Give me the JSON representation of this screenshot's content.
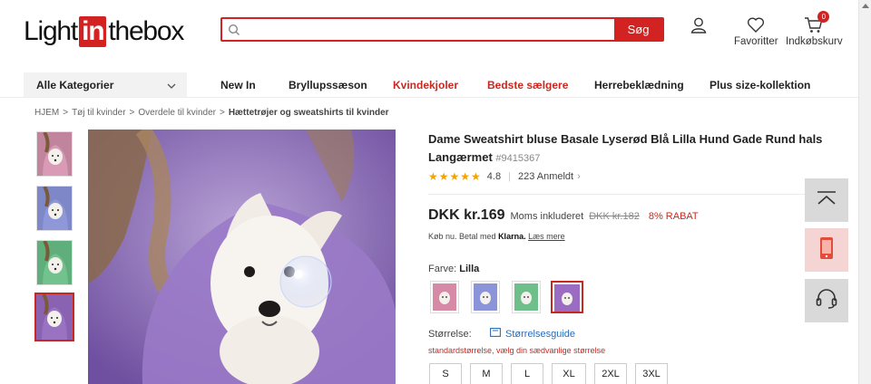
{
  "header": {
    "logo": {
      "pre": "Light",
      "mid": "in",
      "post": "thebox"
    },
    "search": {
      "placeholder": "",
      "button": "Søg"
    },
    "favorites": "Favoritter",
    "cart": {
      "label": "Indkøbskurv",
      "count": "0"
    },
    "icons": [
      "search-icon",
      "account-icon",
      "heart-icon",
      "cart-icon"
    ]
  },
  "nav": {
    "category": "Alle Kategorier",
    "items": [
      {
        "label": "New In",
        "highlight": false
      },
      {
        "label": "Bryllupssæson",
        "highlight": false
      },
      {
        "label": "Kvindekjoler",
        "highlight": true
      },
      {
        "label": "Bedste sælgere",
        "highlight": true
      },
      {
        "label": "Herrebeklædning",
        "highlight": false
      },
      {
        "label": "Plus size-kollektion",
        "highlight": false
      }
    ]
  },
  "breadcrumb": [
    "HJEM",
    "Tøj til kvinder",
    "Overdele til kvinder",
    "Hættetrøjer og sweatshirts til kvinder"
  ],
  "product": {
    "title": "Dame Sweatshirt bluse Basale Lyserød Blå Lilla Hund Gade Rund hals Langærmet",
    "sku": "#9415367",
    "rating": "4.8",
    "reviews": "223 Anmeldt",
    "price": "DKK kr.169",
    "tax_note": "Moms inkluderet",
    "old_price": "DKK kr.182",
    "discount": "8% RABAT",
    "klarna": {
      "pre": "Køb nu. Betal med",
      "brand": "Klarna.",
      "link": "Læs mere"
    },
    "color_label": "Farve:",
    "color_value": "Lilla",
    "colors": [
      "#d78aa6",
      "#8b94d8",
      "#6fbf8a",
      "#9a6cc2"
    ],
    "size_label": "Størrelse:",
    "size_guide": "Størrelsesguide",
    "size_note": "standardstørrelse, vælg din sædvanlige størrelse",
    "sizes": [
      "S",
      "M",
      "L",
      "XL",
      "2XL",
      "3XL"
    ]
  },
  "theme": {
    "accent": "#d32222",
    "link": "#2b6cb8",
    "star": "#f2a300"
  }
}
